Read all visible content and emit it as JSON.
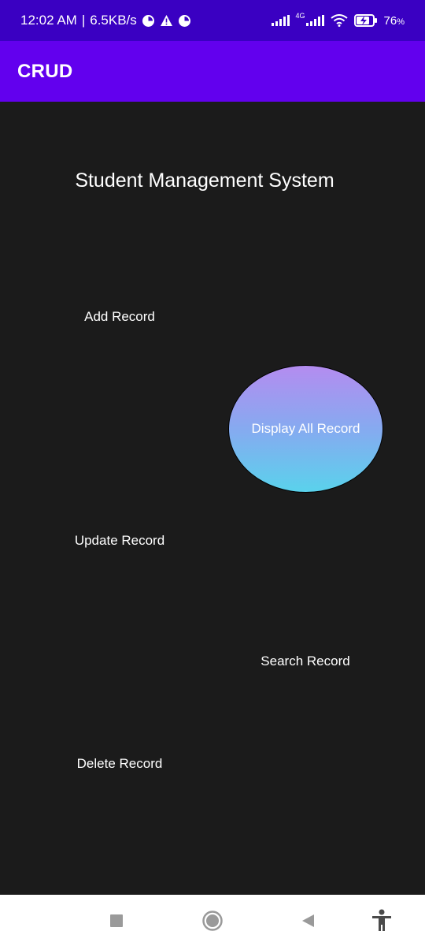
{
  "status_bar": {
    "time": "12:02 AM",
    "separator": "|",
    "speed": "6.5KB/s",
    "network_type": "4G",
    "battery_percent": "76",
    "battery_unit": "%",
    "icons": [
      "data-saver-icon",
      "warning-icon",
      "data-saver-icon",
      "signal-icon",
      "signal-4g-icon",
      "wifi-icon",
      "battery-charging-icon"
    ]
  },
  "app_bar": {
    "title": "CRUD"
  },
  "main": {
    "title": "Student Management System",
    "buttons": {
      "add": "Add Record",
      "display": "Display All Record",
      "update": "Update Record",
      "search": "Search Record",
      "delete": "Delete Record"
    }
  },
  "nav_bar": {
    "icons": [
      "recent-apps-icon",
      "home-icon",
      "back-icon",
      "accessibility-icon"
    ]
  },
  "colors": {
    "status_bar": "#3a00c2",
    "app_bar": "#6200ee",
    "background": "#1b1b1b",
    "display_gradient_top": "#b48cf0",
    "display_gradient_bottom": "#5ad2ec"
  }
}
